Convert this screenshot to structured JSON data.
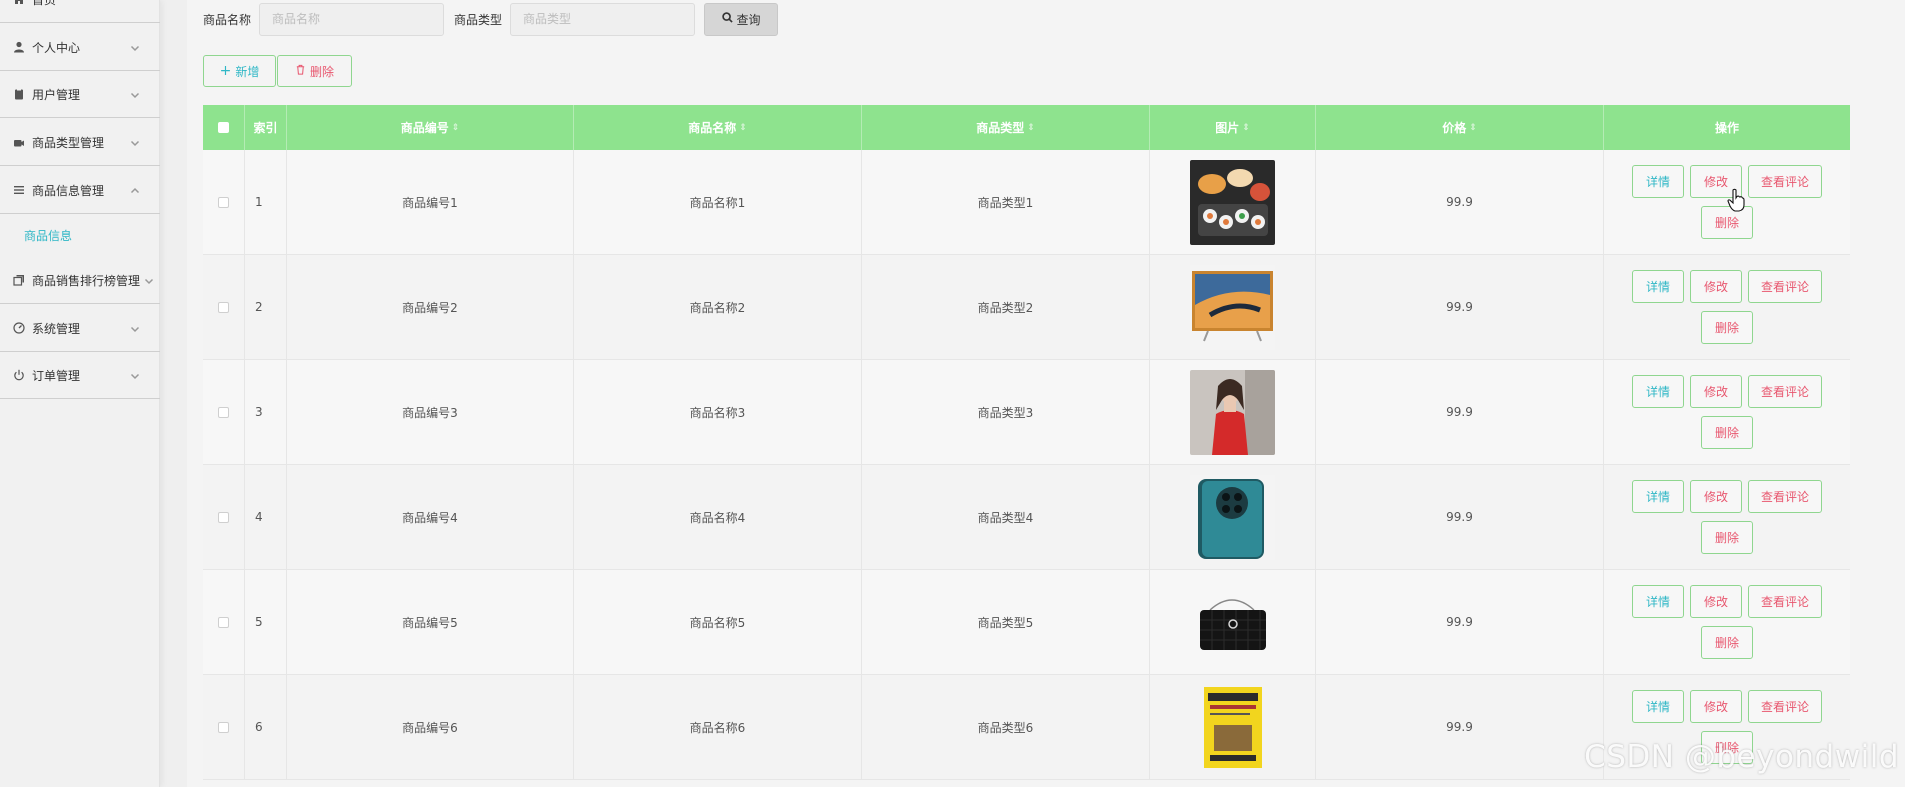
{
  "sidebar": {
    "items": [
      {
        "label": "首页",
        "icon": "home-icon"
      },
      {
        "label": "个人中心",
        "icon": "user-icon"
      },
      {
        "label": "用户管理",
        "icon": "clipboard-icon"
      },
      {
        "label": "商品类型管理",
        "icon": "camera-icon"
      },
      {
        "label": "商品信息管理",
        "icon": "menu-icon"
      },
      {
        "label": "商品销售排行榜管理",
        "icon": "copy-icon"
      },
      {
        "label": "系统管理",
        "icon": "gauge-icon"
      },
      {
        "label": "订单管理",
        "icon": "power-icon"
      }
    ],
    "submenu": {
      "label": "商品信息"
    }
  },
  "search": {
    "name_label": "商品名称",
    "name_placeholder": "商品名称",
    "type_label": "商品类型",
    "type_placeholder": "商品类型",
    "query_button": "查询"
  },
  "actions": {
    "add": "新增",
    "delete": "删除"
  },
  "table": {
    "headers": {
      "index": "索引",
      "code": "商品编号",
      "name": "商品名称",
      "type": "商品类型",
      "image": "图片",
      "price": "价格",
      "ops": "操作"
    },
    "op_labels": {
      "detail": "详情",
      "edit": "修改",
      "comment": "查看评论",
      "delete": "删除"
    },
    "rows": [
      {
        "index": "1",
        "code": "商品编号1",
        "name": "商品名称1",
        "type": "商品类型1",
        "price": "99.9",
        "image": "sushi-plate"
      },
      {
        "index": "2",
        "code": "商品编号2",
        "name": "商品名称2",
        "type": "商品类型2",
        "price": "99.9",
        "image": "television"
      },
      {
        "index": "3",
        "code": "商品编号3",
        "name": "商品名称3",
        "type": "商品类型3",
        "price": "99.9",
        "image": "red-dress-model"
      },
      {
        "index": "4",
        "code": "商品编号4",
        "name": "商品名称4",
        "type": "商品类型4",
        "price": "99.9",
        "image": "smartphone"
      },
      {
        "index": "5",
        "code": "商品编号5",
        "name": "商品名称5",
        "type": "商品类型5",
        "price": "99.9",
        "image": "black-handbag"
      },
      {
        "index": "6",
        "code": "商品编号6",
        "name": "商品名称6",
        "type": "商品类型6",
        "price": "99.9",
        "image": "yellow-book"
      }
    ]
  },
  "watermark": "CSDN @beyondwild",
  "colors": {
    "header_bg": "#8ee38e",
    "accent_teal": "#2fb7c6",
    "accent_pink": "#e8576f",
    "button_border": "#8fd68f"
  }
}
